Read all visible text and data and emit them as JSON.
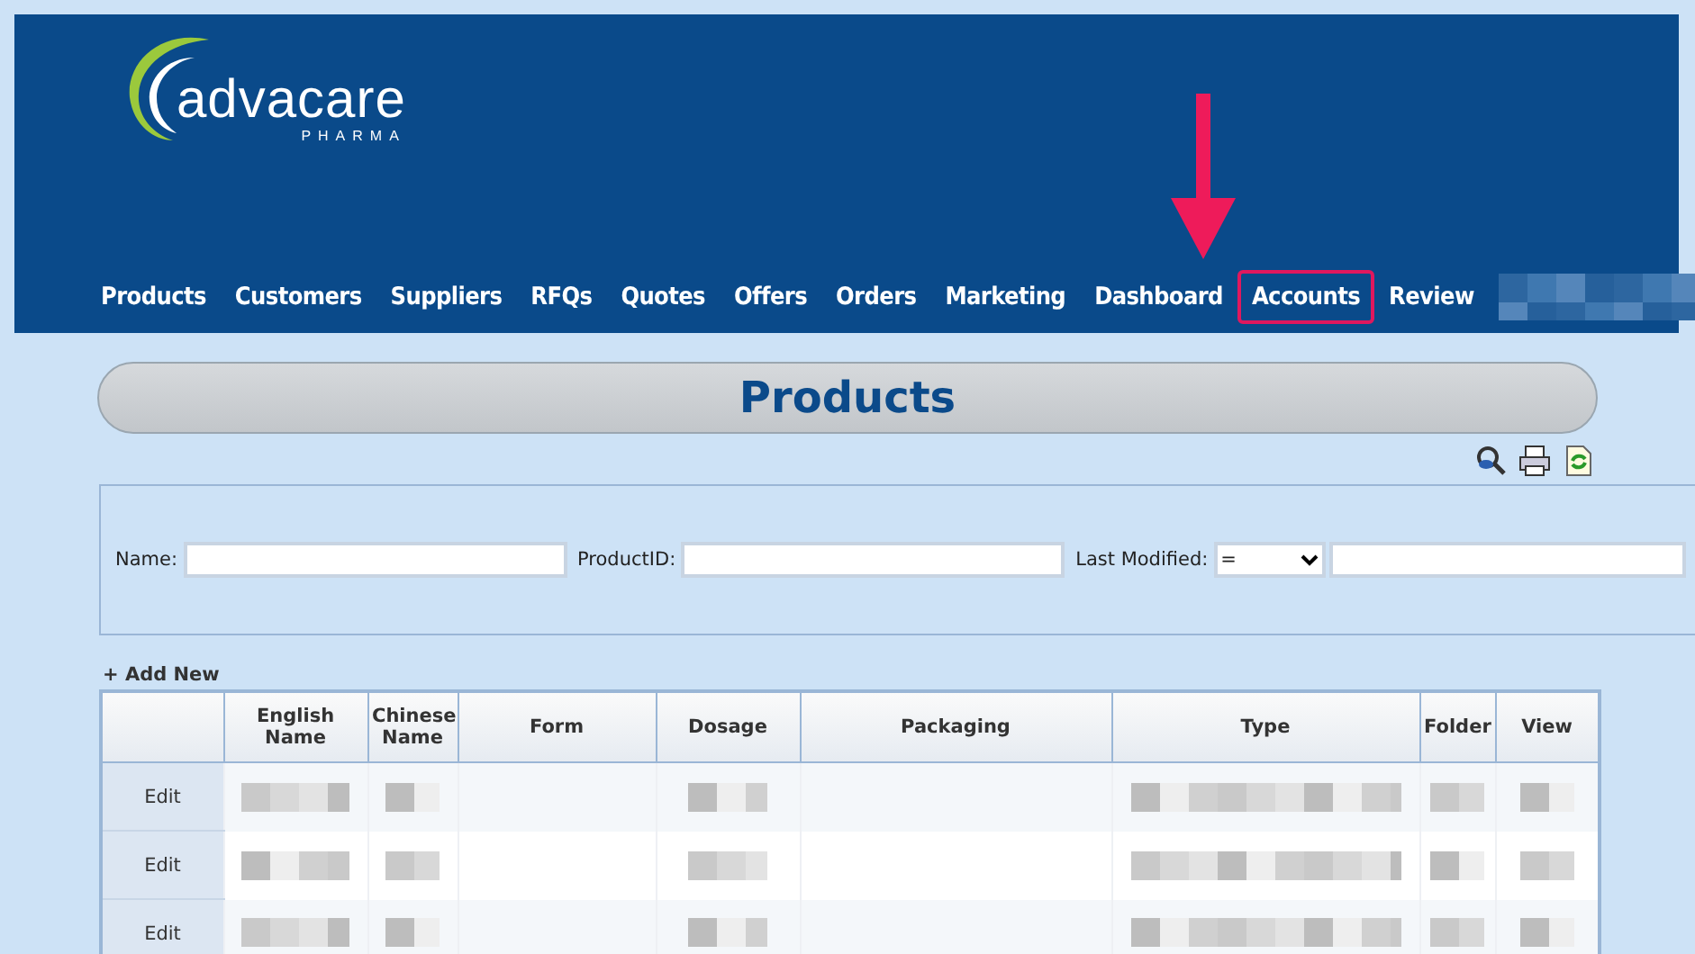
{
  "logo": {
    "name": "advacare",
    "tagline": "PHARMA"
  },
  "nav": [
    {
      "label": "Products",
      "highlighted": false
    },
    {
      "label": "Customers",
      "highlighted": false
    },
    {
      "label": "Suppliers",
      "highlighted": false
    },
    {
      "label": "RFQs",
      "highlighted": false
    },
    {
      "label": "Quotes",
      "highlighted": false
    },
    {
      "label": "Offers",
      "highlighted": false
    },
    {
      "label": "Orders",
      "highlighted": false
    },
    {
      "label": "Marketing",
      "highlighted": false
    },
    {
      "label": "Dashboard",
      "highlighted": false
    },
    {
      "label": "Accounts",
      "highlighted": true
    },
    {
      "label": "Review",
      "highlighted": false
    }
  ],
  "page_title": "Products",
  "filters": [
    {
      "kind": "text",
      "label": "Name:"
    },
    {
      "kind": "text",
      "label": "ProductID:"
    },
    {
      "kind": "date",
      "label": "Last Modified:",
      "operator": "="
    }
  ],
  "add_new": "+ Add New",
  "table": {
    "columns": [
      "English Name",
      "Chinese Name",
      "Form",
      "Dosage",
      "Packaging",
      "Type",
      "Folder",
      "View"
    ],
    "rows": [
      {
        "action": "Edit"
      },
      {
        "action": "Edit"
      },
      {
        "action": "Edit"
      }
    ]
  }
}
